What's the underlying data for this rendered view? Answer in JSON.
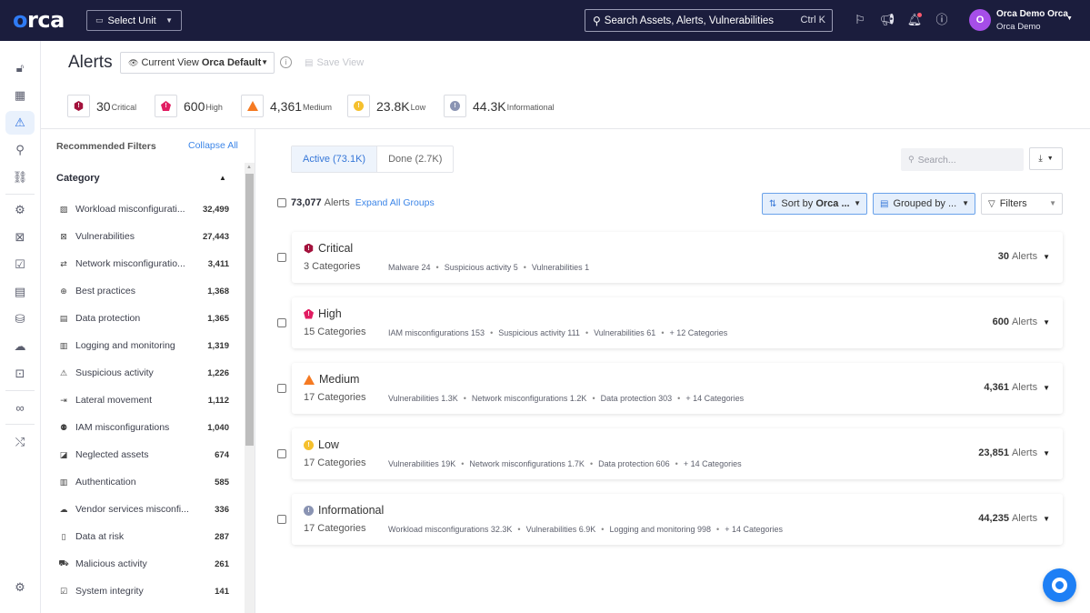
{
  "topbar": {
    "logo": "orca",
    "unit_select": "Select Unit",
    "search_placeholder": "Search Assets, Alerts, Vulnerabilities",
    "search_shortcut": "Ctrl K",
    "user_initial": "O",
    "user_name": "Orca Demo Orca",
    "user_org": "Orca Demo"
  },
  "header": {
    "title": "Alerts",
    "view_prefix": "Current View",
    "view_name": "Orca Default",
    "save_view": "Save View"
  },
  "severity_summary": [
    {
      "count": "30",
      "label": "Critical",
      "color": "#a3123c"
    },
    {
      "count": "600",
      "label": "High",
      "color": "#e11d62"
    },
    {
      "count": "4,361",
      "label": "Medium",
      "color": "#f57a22"
    },
    {
      "count": "23.8K",
      "label": "Low",
      "color": "#f5c02e"
    },
    {
      "count": "44.3K",
      "label": "Informational",
      "color": "#8a94b3"
    }
  ],
  "filters": {
    "title": "Recommended Filters",
    "collapse_all": "Collapse All",
    "category_title": "Category",
    "items": [
      {
        "label": "Workload misconfigurati...",
        "count": "32,499"
      },
      {
        "label": "Vulnerabilities",
        "count": "27,443"
      },
      {
        "label": "Network misconfiguratio...",
        "count": "3,411"
      },
      {
        "label": "Best practices",
        "count": "1,368"
      },
      {
        "label": "Data protection",
        "count": "1,365"
      },
      {
        "label": "Logging and monitoring",
        "count": "1,319"
      },
      {
        "label": "Suspicious activity",
        "count": "1,226"
      },
      {
        "label": "Lateral movement",
        "count": "1,112"
      },
      {
        "label": "IAM misconfigurations",
        "count": "1,040"
      },
      {
        "label": "Neglected assets",
        "count": "674"
      },
      {
        "label": "Authentication",
        "count": "585"
      },
      {
        "label": "Vendor services misconfi...",
        "count": "336"
      },
      {
        "label": "Data at risk",
        "count": "287"
      },
      {
        "label": "Malicious activity",
        "count": "261"
      },
      {
        "label": "System integrity",
        "count": "141"
      }
    ]
  },
  "main": {
    "tabs": [
      {
        "label": "Active (73.1K)"
      },
      {
        "label": "Done (2.7K)"
      }
    ],
    "search_placeholder": "Search...",
    "total_count": "73,077",
    "total_label": "Alerts",
    "expand_all": "Expand All Groups",
    "sort_prefix": "Sort by",
    "sort_value": "Orca ...",
    "group_by": "Grouped by ...",
    "filters": "Filters",
    "groups": [
      {
        "severity": "Critical",
        "categories": "3 Categories",
        "breakdown": [
          "Malware 24",
          "Suspicious activity 5",
          "Vulnerabilities 1"
        ],
        "count": "30",
        "count_label": "Alerts"
      },
      {
        "severity": "High",
        "categories": "15 Categories",
        "breakdown": [
          "IAM misconfigurations 153",
          "Suspicious activity 111",
          "Vulnerabilities 61",
          "+ 12 Categories"
        ],
        "count": "600",
        "count_label": "Alerts"
      },
      {
        "severity": "Medium",
        "categories": "17 Categories",
        "breakdown": [
          "Vulnerabilities 1.3K",
          "Network misconfigurations 1.2K",
          "Data protection 303",
          "+ 14 Categories"
        ],
        "count": "4,361",
        "count_label": "Alerts"
      },
      {
        "severity": "Low",
        "categories": "17 Categories",
        "breakdown": [
          "Vulnerabilities 19K",
          "Network misconfigurations 1.7K",
          "Data protection 606",
          "+ 14 Categories"
        ],
        "count": "23,851",
        "count_label": "Alerts"
      },
      {
        "severity": "Informational",
        "categories": "17 Categories",
        "breakdown": [
          "Workload misconfigurations 32.3K",
          "Vulnerabilities 6.9K",
          "Logging and monitoring 998",
          "+ 14 Categories"
        ],
        "count": "44,235",
        "count_label": "Alerts"
      }
    ]
  }
}
